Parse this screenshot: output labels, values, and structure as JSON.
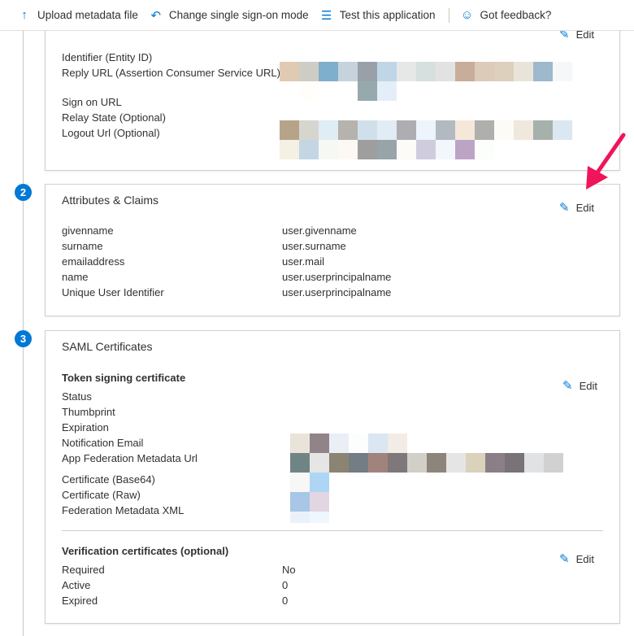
{
  "toolbar": {
    "upload": "Upload metadata file",
    "change": "Change single sign-on mode",
    "test": "Test this application",
    "feedback": "Got feedback?"
  },
  "section1": {
    "edit": "Edit",
    "labels": [
      "Identifier (Entity ID)",
      "Reply URL (Assertion Consumer Service URL)",
      "Sign on URL",
      "Relay State (Optional)",
      "Logout Url (Optional)"
    ]
  },
  "section2": {
    "step": "2",
    "title": "Attributes & Claims",
    "edit": "Edit",
    "rows": [
      {
        "label": "givenname",
        "value": "user.givenname"
      },
      {
        "label": "surname",
        "value": "user.surname"
      },
      {
        "label": "emailaddress",
        "value": "user.mail"
      },
      {
        "label": "name",
        "value": "user.userprincipalname"
      },
      {
        "label": "Unique User Identifier",
        "value": "user.userprincipalname"
      }
    ]
  },
  "section3": {
    "step": "3",
    "title": "SAML Certificates",
    "token_title": "Token signing certificate",
    "edit": "Edit",
    "labels": [
      "Status",
      "Thumbprint",
      "Expiration",
      "Notification Email",
      "App Federation Metadata Url",
      "Certificate (Base64)",
      "Certificate (Raw)",
      "Federation Metadata XML"
    ],
    "verif_title": "Verification certificates (optional)",
    "verif_edit": "Edit",
    "verif_rows": [
      {
        "label": "Required",
        "value": "No"
      },
      {
        "label": "Active",
        "value": "0"
      },
      {
        "label": "Expired",
        "value": "0"
      }
    ]
  },
  "redacted": {
    "reply_url": [
      [
        "#e0cab2",
        "#cecdc5",
        "#7eafcc",
        "#c6d3dc",
        "#9aa0a8",
        "#c0d6e6",
        "#e6e8e8",
        "#d6e0df",
        "#e2e2e2",
        "#c8ad9a",
        "#dbcbb8",
        "#ddd0bd",
        "#e8e4da",
        "#9eb8cc",
        "#f6f7f9"
      ],
      [
        "#ffffff",
        "#fffefa",
        "#ffffff",
        "#ffffff",
        "#96aaad",
        "#e4eef8"
      ]
    ],
    "logout_url": [
      [
        "#b6a48a",
        "#d6d6cf",
        "#dfedf5",
        "#b6b2ad",
        "#d0e0ea",
        "#e2ecf5",
        "#aeadb1",
        "#edf4fc",
        "#b2b9c1",
        "#f5e8d8",
        "#afafae",
        "#fcfbf7",
        "#f0e8dc",
        "#a6b1ac",
        "#dbe7f1"
      ],
      [
        "#f4f0e4",
        "#c4d6e4",
        "#f6f8f4",
        "#fcf8f4",
        "#9e9e9e",
        "#98a4a8",
        "#fcfbf7",
        "#cfcddd",
        "#f2f7fc",
        "#bca4c6",
        "#fcfefc"
      ]
    ],
    "cert": [
      [
        "#eae3da",
        "#918489",
        "#eaeff6",
        "#fcfdfd",
        "#dae6f1",
        "#f2ebe6"
      ],
      [
        "#6f8585",
        "#e5e5e5",
        "#8c8472",
        "#747c84",
        "#a1837e",
        "#7f787b",
        "#d1cfc8",
        "#8d857b",
        "#e5e5e5",
        "#dbd2bc",
        "#8b7f87",
        "#797378",
        "#e1e2e4",
        "#d1d1d1"
      ],
      [
        "#f6f7f6",
        "#aed5f4"
      ],
      [
        "#a8c6e5",
        "#e2d6e2"
      ],
      [
        "#ebf1fa",
        "#f0f6fd"
      ]
    ]
  },
  "colors": {
    "accent": "#0078d4",
    "arrow": "#f0145a"
  }
}
